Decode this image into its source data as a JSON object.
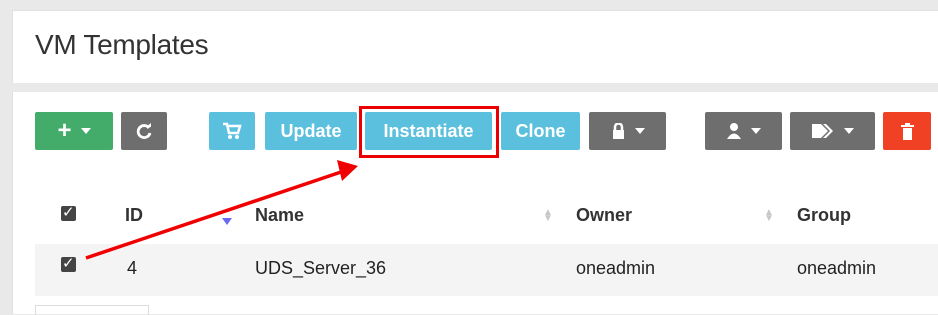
{
  "title": "VM Templates",
  "toolbar": {
    "update": "Update",
    "instantiate": "Instantiate",
    "clone": "Clone"
  },
  "table": {
    "headers": [
      "ID",
      "Name",
      "Owner",
      "Group"
    ],
    "rows": [
      {
        "id": "4",
        "name": "UDS_Server_36",
        "owner": "oneadmin",
        "group": "oneadmin",
        "selected": true
      }
    ]
  },
  "icons": {
    "create": "plus-icon",
    "refresh": "refresh-icon",
    "cart": "cart-icon",
    "lock": "lock-icon",
    "user": "user-icon",
    "tag": "tag-icon",
    "delete": "trash-icon"
  },
  "colors": {
    "create": "#43ac6a",
    "action": "#5bc0de",
    "secondary": "#6e6e6e",
    "delete": "#f04124",
    "callout": "#ea0000"
  }
}
